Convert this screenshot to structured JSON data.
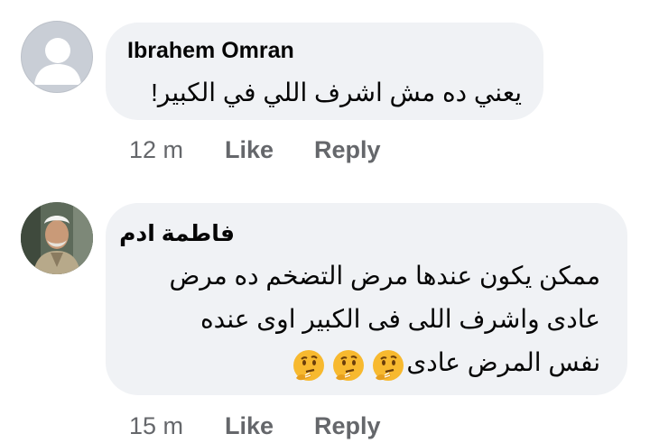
{
  "comments": [
    {
      "author": "Ibrahem Omran",
      "avatar": "default-avatar-icon",
      "text_lines": [
        "يعني ده مش اشرف اللي في الكبير!"
      ],
      "time": "12 m",
      "like_label": "Like",
      "reply_label": "Reply"
    },
    {
      "author": "فاطمة ادم",
      "avatar": "profile-photo",
      "text_lines": [
        "ممكن يكون عندها مرض التضخم ده مرض",
        "عادى واشرف اللى فى الكبير اوى عنده",
        "نفس المرض عادى"
      ],
      "emojis": [
        "thinking-face-icon",
        "thinking-face-icon",
        "thinking-face-icon"
      ],
      "time": "15 m",
      "like_label": "Like",
      "reply_label": "Reply"
    }
  ],
  "colors": {
    "bubble_bg": "#f0f2f5",
    "meta_text": "#65676b",
    "primary_text": "#050505"
  }
}
